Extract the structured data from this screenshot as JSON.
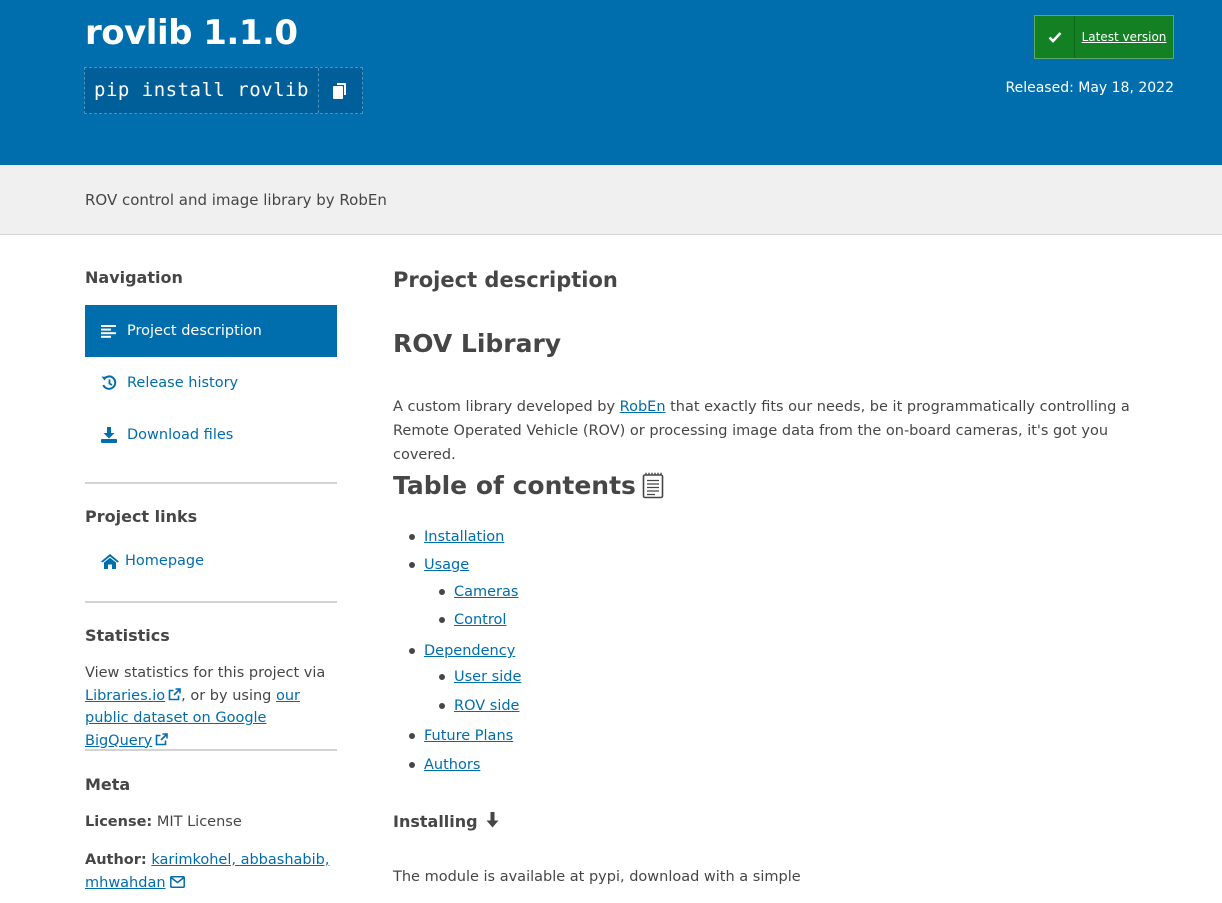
{
  "header": {
    "title": "rovlib 1.1.0",
    "pip_command": "pip install rovlib",
    "latest_version_label": "Latest version",
    "released_label": "Released: May 18, 2022"
  },
  "summary": "ROV control and image library by RobEn",
  "sidebar": {
    "navigation_heading": "Navigation",
    "nav_items": [
      {
        "label": "Project description",
        "icon": "align-left-icon",
        "active": true
      },
      {
        "label": "Release history",
        "icon": "history-icon",
        "active": false
      },
      {
        "label": "Download files",
        "icon": "download-icon",
        "active": false
      }
    ],
    "project_links_heading": "Project links",
    "homepage_label": "Homepage",
    "statistics_heading": "Statistics",
    "statistics_text_1": "View statistics for this project via",
    "libraries_io_link": "Libraries.io",
    "statistics_text_2": ", or by using",
    "bigquery_link": "our public dataset on Google BigQuery",
    "meta_heading": "Meta",
    "license_label": "License:",
    "license_value": "MIT License",
    "author_label": "Author:",
    "author_value": "karimkohel, abbashabib, mhwahdan"
  },
  "main": {
    "project_description_heading": "Project description",
    "library_heading": "ROV Library",
    "intro_before_link": "A custom library developed by",
    "intro_link": "RobEn",
    "intro_after_link": "that exactly fits our needs, be it programmatically controlling a Remote Operated Vehicle (ROV) or processing image data from the on-board cameras, it's got you covered.",
    "toc_heading": "Table of contents",
    "toc": {
      "installation": "Installation",
      "usage": "Usage",
      "cameras": "Cameras",
      "control": "Control",
      "dependency": "Dependency",
      "user_side": "User side",
      "rov_side": "ROV side",
      "future_plans": "Future Plans",
      "authors": "Authors"
    },
    "installing_heading": "Installing",
    "installing_text": "The module is available at pypi, download with a simple"
  },
  "colors": {
    "brand_blue": "#006dad",
    "latest_green": "#148024",
    "summary_bg": "#f0f0f0",
    "text": "#464646"
  }
}
